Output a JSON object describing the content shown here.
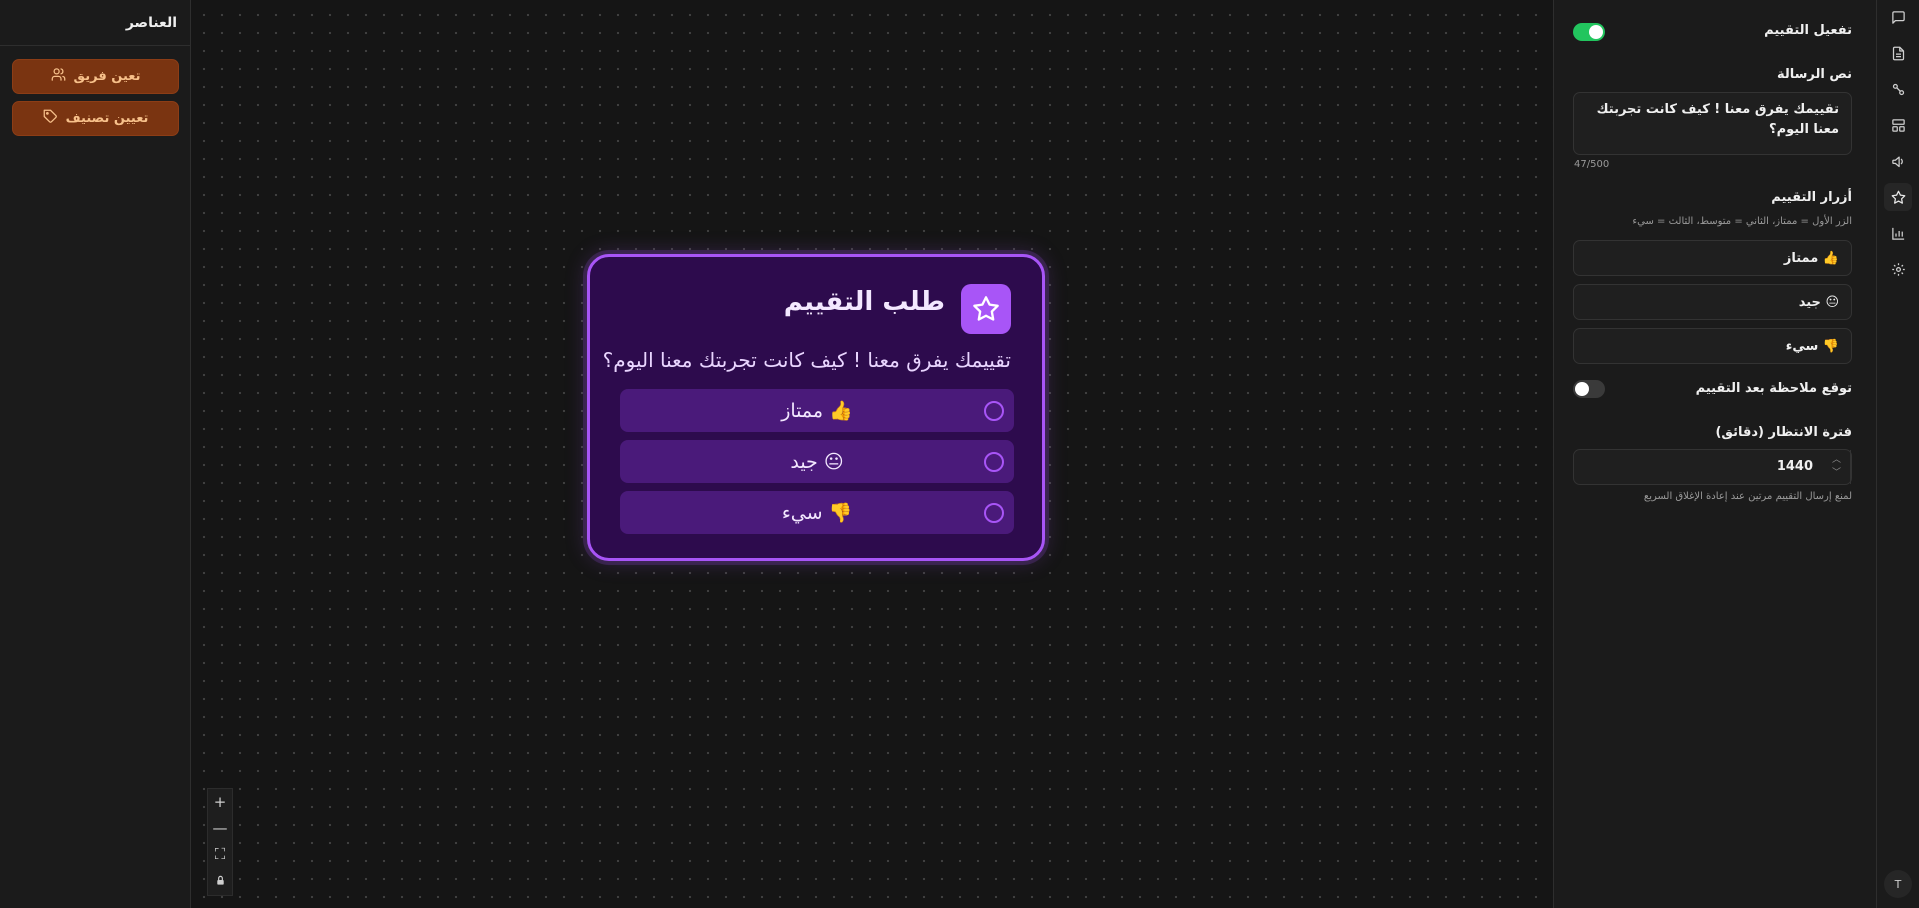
{
  "left_panel": {
    "title": "العناصر",
    "items": [
      {
        "label": "تعين فريق",
        "icon": "users-icon"
      },
      {
        "label": "تعيين تصنيف",
        "icon": "tag-icon"
      }
    ]
  },
  "node": {
    "title": "طلب التقييم",
    "message": "تقييمك يفرق معنا ! كيف كانت تجربتك معنا اليوم؟",
    "options": [
      "👍 ممتاز",
      "😐 جيد",
      "👎 سيء"
    ],
    "accent": "#a855f7",
    "background": "#2d0b4d"
  },
  "zoom_controls": {
    "zoom_in": "+",
    "zoom_out": "—",
    "fit": "⛶",
    "lock": "🔒"
  },
  "properties": {
    "enable_label": "تفعيل التقييم",
    "enable_on": true,
    "message_label": "نص الرسالة",
    "message_value": "تقييمك يفرق معنا ! كيف كانت تجربتك معنا اليوم؟",
    "char_count": "47/500",
    "buttons_label": "أزرار التقييم",
    "buttons_hint": "الزر الأول = ممتاز، الثاني = متوسط، الثالث = سيء",
    "buttons": [
      "👍 ممتاز",
      "😐 جيد",
      "👎 سيء"
    ],
    "expect_note_label": "توقع ملاحظة بعد التقييم",
    "expect_note_on": false,
    "wait_label": "فترة الانتظار (دقائق)",
    "wait_value": "1440",
    "wait_hint": "لمنع إرسال التقييم مرتين عند إعادة الإغلاق السريع",
    "toggle_on_color": "#22c55e",
    "toggle_off_color": "#3a3a3a"
  },
  "rail": {
    "icons": [
      "message-square-icon",
      "file-text-icon",
      "workflow-icon",
      "layout-icon",
      "megaphone-icon",
      "star-icon",
      "bar-chart-icon",
      "settings-icon"
    ],
    "active": "star-icon",
    "avatar": "T"
  }
}
